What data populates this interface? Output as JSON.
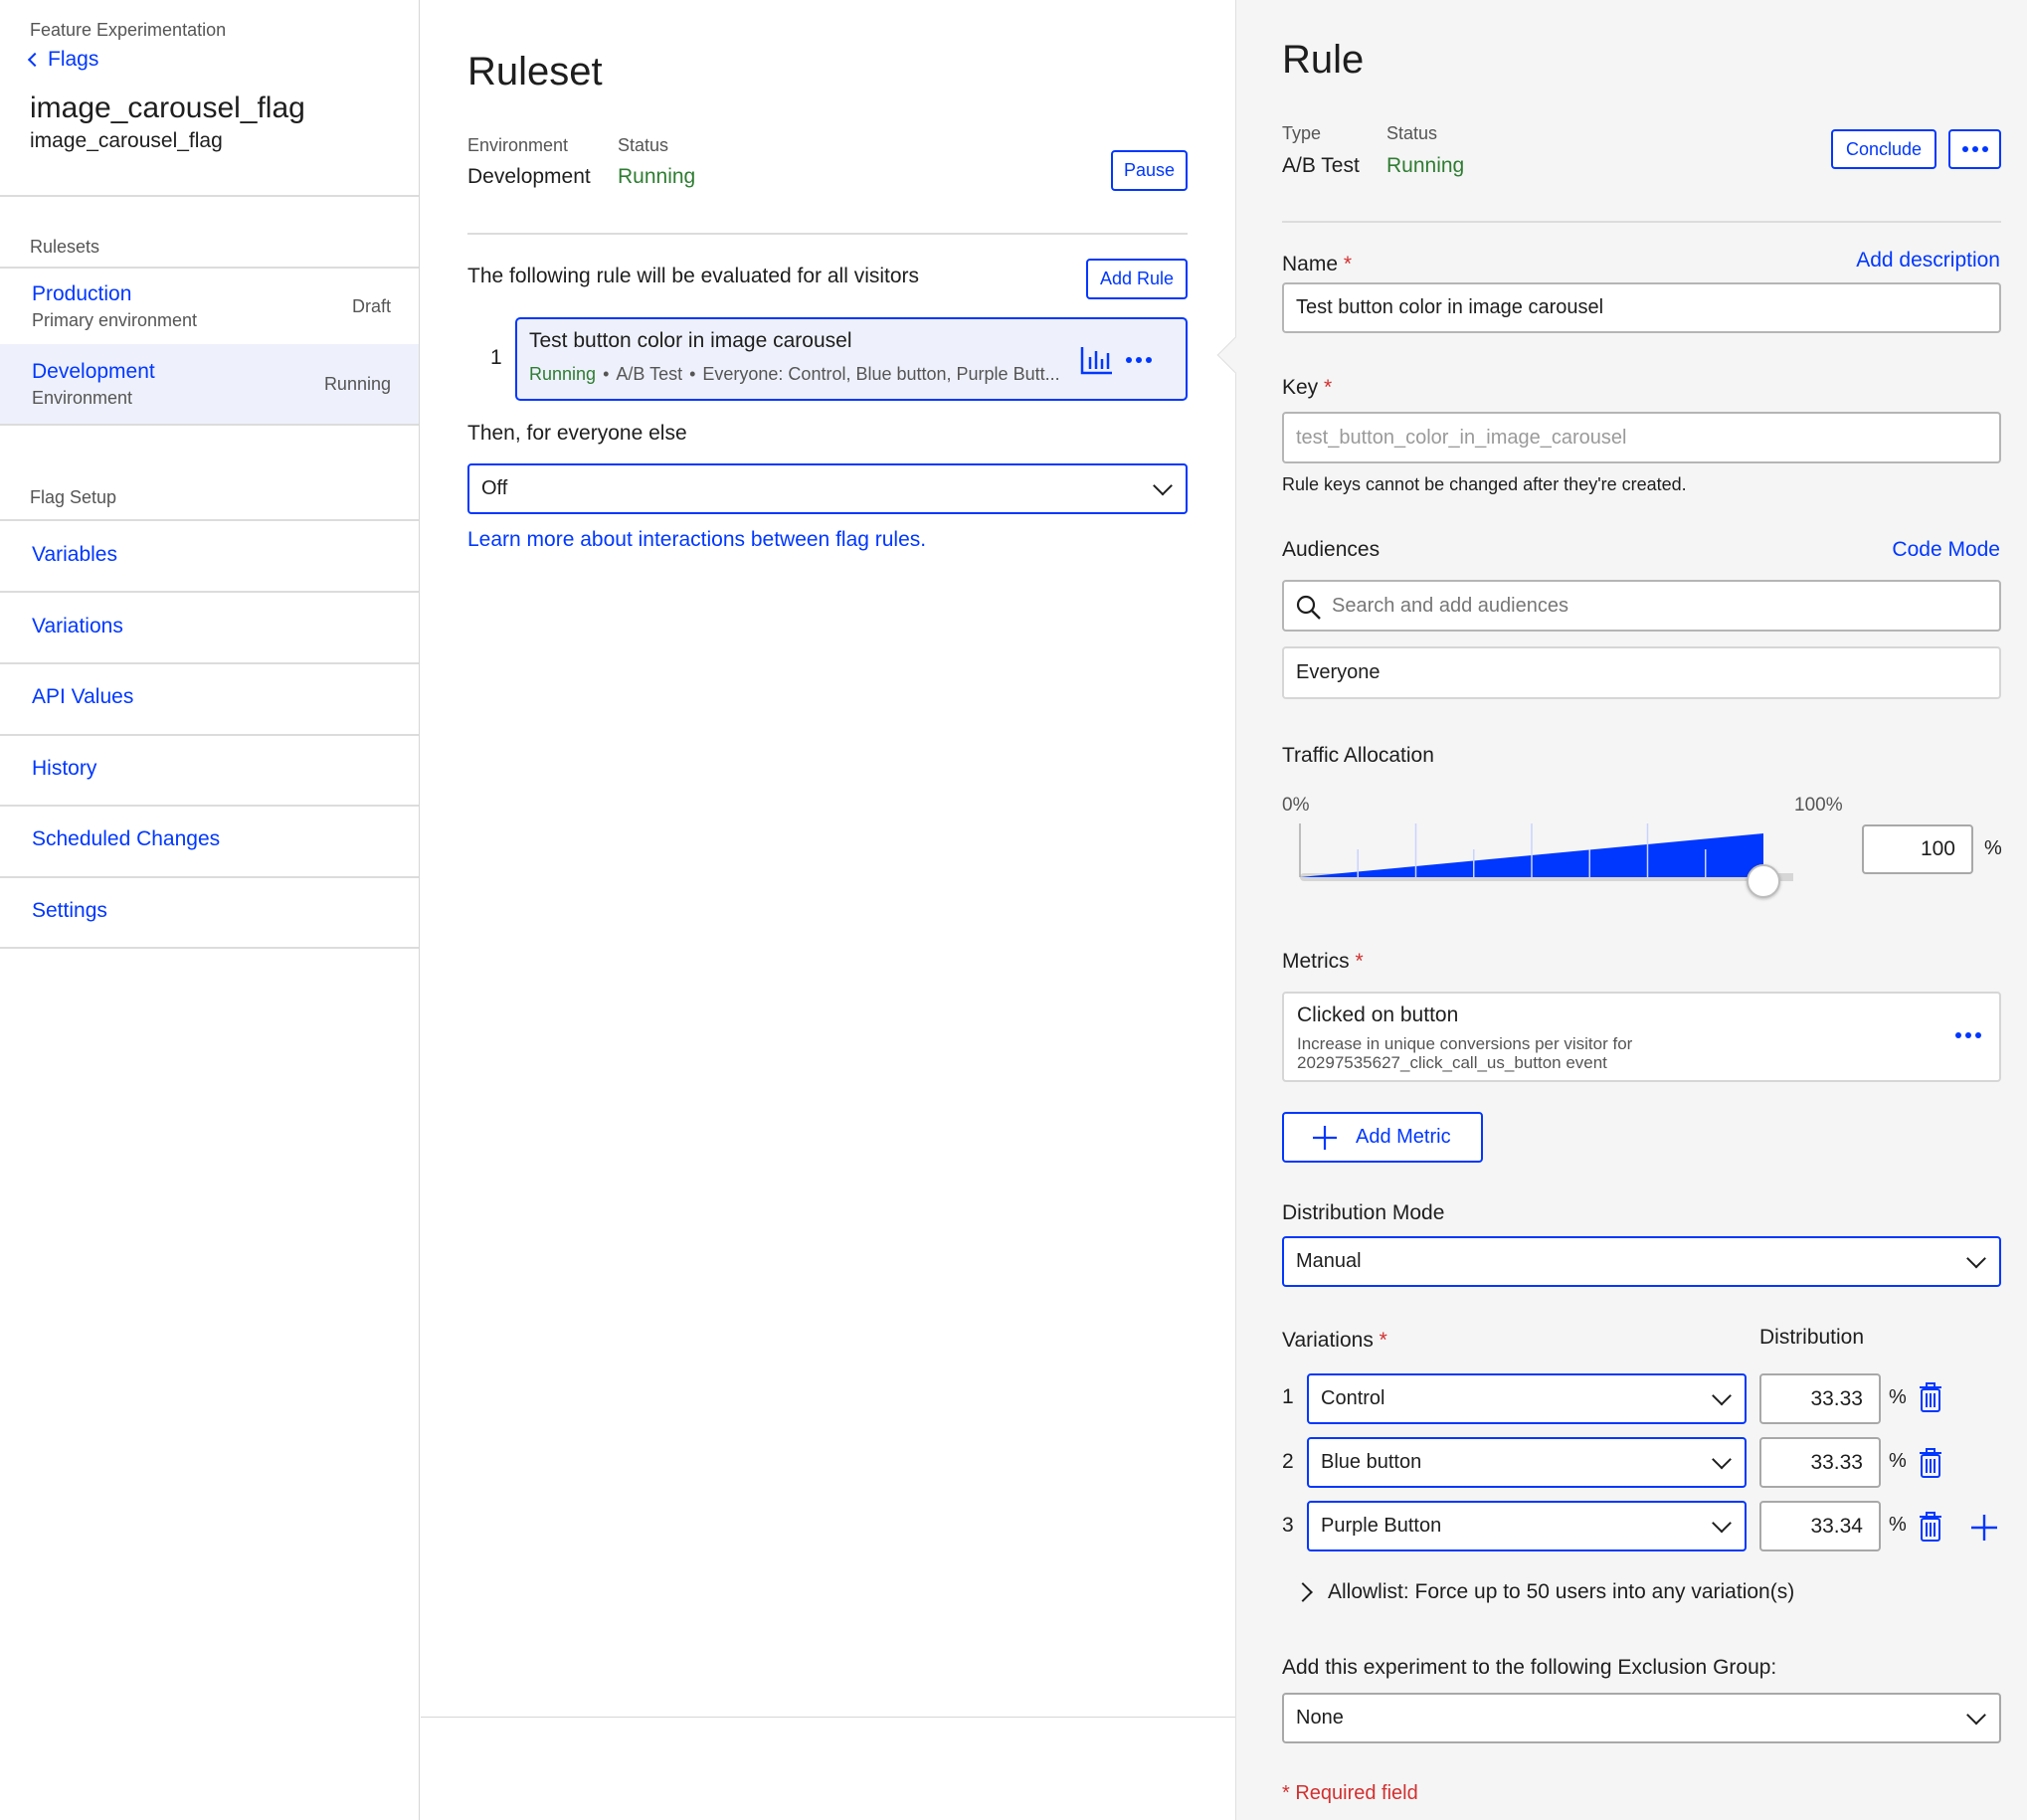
{
  "sidebar": {
    "product": "Feature Experimentation",
    "back_label": "Flags",
    "flag_name": "image_carousel_flag",
    "flag_key": "image_carousel_flag",
    "rulesets_heading": "Rulesets",
    "rulesets": [
      {
        "name": "Production",
        "sub": "Primary environment",
        "status": "Draft"
      },
      {
        "name": "Development",
        "sub": "Environment",
        "status": "Running"
      }
    ],
    "flag_setup_heading": "Flag Setup",
    "nav": [
      "Variables",
      "Variations",
      "API Values",
      "History",
      "Scheduled Changes",
      "Settings"
    ]
  },
  "ruleset": {
    "title": "Ruleset",
    "env_label": "Environment",
    "env_value": "Development",
    "status_label": "Status",
    "status_value": "Running",
    "pause_label": "Pause",
    "evaluated_text": "The following rule will be evaluated for all visitors",
    "add_rule_label": "Add Rule",
    "rule_index": "1",
    "rule_title": "Test button color in image carousel",
    "rule_status": "Running",
    "rule_type": "A/B Test",
    "rule_audience": "Everyone: Control, Blue button, Purple Butt...",
    "bullet": "•",
    "else_text": "Then, for everyone else",
    "else_value": "Off",
    "learn_more": "Learn more about interactions between flag rules."
  },
  "rule": {
    "title": "Rule",
    "type_label": "Type",
    "type_value": "A/B Test",
    "status_label": "Status",
    "status_value": "Running",
    "conclude_label": "Conclude",
    "name_label": "Name",
    "required_star": "*",
    "add_description": "Add description",
    "name_value": "Test button color in image carousel",
    "key_label": "Key",
    "key_placeholder": "test_button_color_in_image_carousel",
    "key_help": "Rule keys cannot be changed after they're created.",
    "audiences_label": "Audiences",
    "code_mode": "Code Mode",
    "audience_search_placeholder": "Search and add audiences",
    "audience_value": "Everyone",
    "traffic_label": "Traffic Allocation",
    "traffic_min": "0%",
    "traffic_max": "100%",
    "traffic_value": "100",
    "traffic_fraction": 1.0,
    "percent_sign": "%",
    "metrics_label": "Metrics",
    "metric_title": "Clicked on button",
    "metric_desc_1": "Increase in unique conversions per visitor for",
    "metric_desc_2": "20297535627_click_call_us_button event",
    "add_metric_label": "Add Metric",
    "distribution_mode_label": "Distribution Mode",
    "distribution_mode_value": "Manual",
    "variations_label": "Variations",
    "distribution_label": "Distribution",
    "variations": [
      {
        "index": "1",
        "name": "Control",
        "dist": "33.33"
      },
      {
        "index": "2",
        "name": "Blue button",
        "dist": "33.33"
      },
      {
        "index": "3",
        "name": "Purple Button",
        "dist": "33.34"
      }
    ],
    "allowlist_label": "Allowlist: Force up to 50 users into any variation(s)",
    "exclusion_label": "Add this experiment to the following Exclusion Group:",
    "exclusion_value": "None",
    "required_field": "* Required field"
  },
  "colors": {
    "accent": "#0037ff",
    "running": "#2e7d32",
    "required": "#d32f2f"
  }
}
